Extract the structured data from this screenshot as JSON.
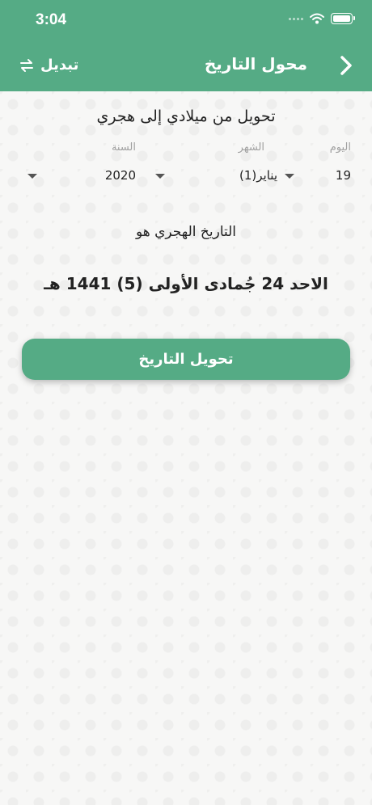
{
  "status_bar": {
    "time": "3:04"
  },
  "header": {
    "title": "محول التاريخ",
    "swap_label": "تبديل"
  },
  "converter": {
    "section_title": "تحويل من ميلادي إلى هجري",
    "fields": {
      "day": {
        "label": "اليوم",
        "value": "19"
      },
      "month": {
        "label": "الشهر",
        "value": "يناير(1)"
      },
      "year": {
        "label": "السنة",
        "value": "2020"
      }
    },
    "result_label": "التاريخ الهجري هو",
    "result_value": "الاحد 24 جُمادى الأولى (5) 1441 هـ",
    "convert_button": "تحويل التاريخ"
  },
  "colors": {
    "primary": "#55ab85",
    "background": "#f7f7f6"
  }
}
